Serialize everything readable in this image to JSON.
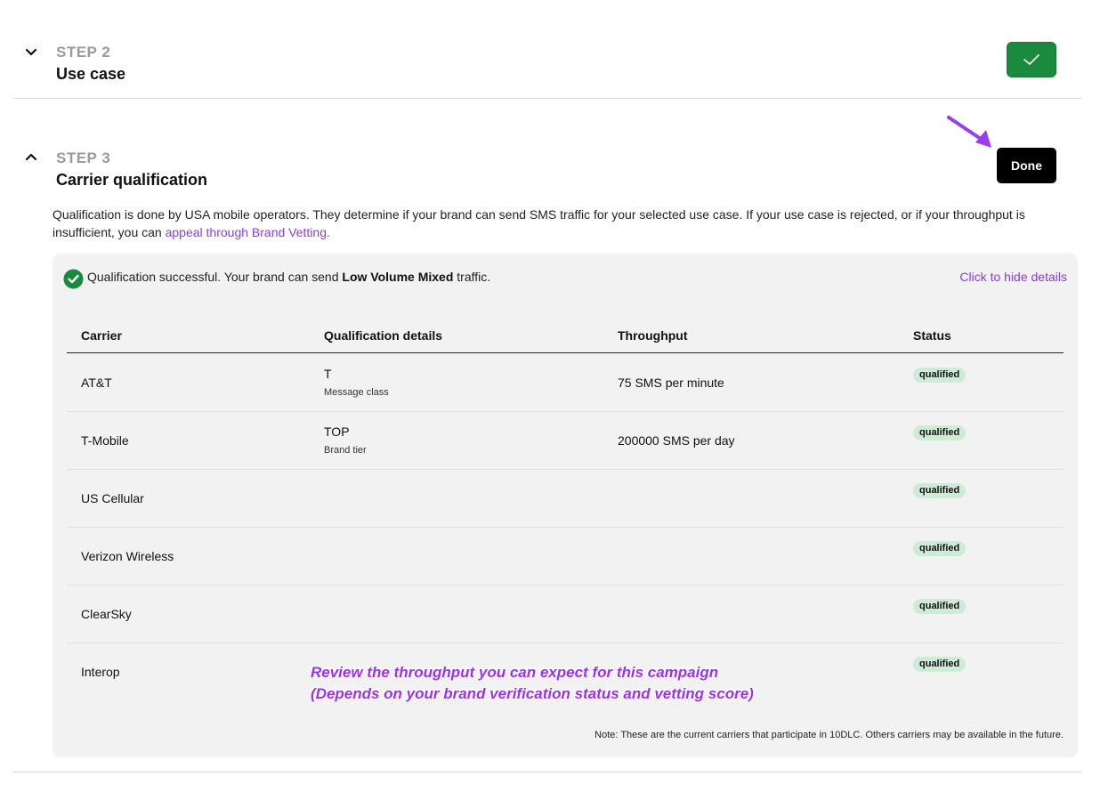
{
  "step2": {
    "label": "STEP 2",
    "title": "Use case"
  },
  "step3": {
    "label": "STEP 3",
    "title": "Carrier qualification",
    "done_label": "Done",
    "description": "Qualification is done by USA mobile operators. They determine if your brand can send SMS traffic for your selected use case. If your use case is rejected, or if your throughput is insufficient, you can ",
    "appeal_link": "appeal through Brand Vetting."
  },
  "qualification": {
    "prefix": "Qualification successful. Your brand can send ",
    "traffic_type": "Low Volume Mixed",
    "suffix": " traffic.",
    "hide_link": "Click to hide details"
  },
  "table": {
    "headers": [
      "Carrier",
      "Qualification details",
      "Throughput",
      "Status"
    ],
    "rows": [
      {
        "carrier": "AT&T",
        "detail_value": "T",
        "detail_label": "Message class",
        "throughput": "75 SMS per minute",
        "status": "qualified"
      },
      {
        "carrier": "T-Mobile",
        "detail_value": "TOP",
        "detail_label": "Brand tier",
        "throughput": "200000 SMS per day",
        "status": "qualified"
      },
      {
        "carrier": "US Cellular",
        "detail_value": "",
        "detail_label": "",
        "throughput": "",
        "status": "qualified"
      },
      {
        "carrier": "Verizon Wireless",
        "detail_value": "",
        "detail_label": "",
        "throughput": "",
        "status": "qualified"
      },
      {
        "carrier": "ClearSky",
        "detail_value": "",
        "detail_label": "",
        "throughput": "",
        "status": "qualified"
      },
      {
        "carrier": "Interop",
        "detail_value": "",
        "detail_label": "",
        "throughput": "",
        "status": "qualified"
      }
    ],
    "note": "Note: These are the current carriers that participate in 10DLC. Others carriers may be available in the future."
  },
  "annotation": {
    "line1": "Review the throughput you can expect for this campaign",
    "line2": "(Depends on your brand verification status and vetting score)"
  },
  "colors": {
    "success_green": "#1a8a3e",
    "link_purple": "#8a3ce6",
    "badge_green": "#cdebd5",
    "annotation_purple": "#9b30f0"
  },
  "icons": {
    "step2_toggle": "chevron-down-icon",
    "step3_toggle": "chevron-up-icon",
    "complete": "check-icon",
    "success": "check-circle-icon",
    "annotation_arrow": "arrow-icon"
  }
}
